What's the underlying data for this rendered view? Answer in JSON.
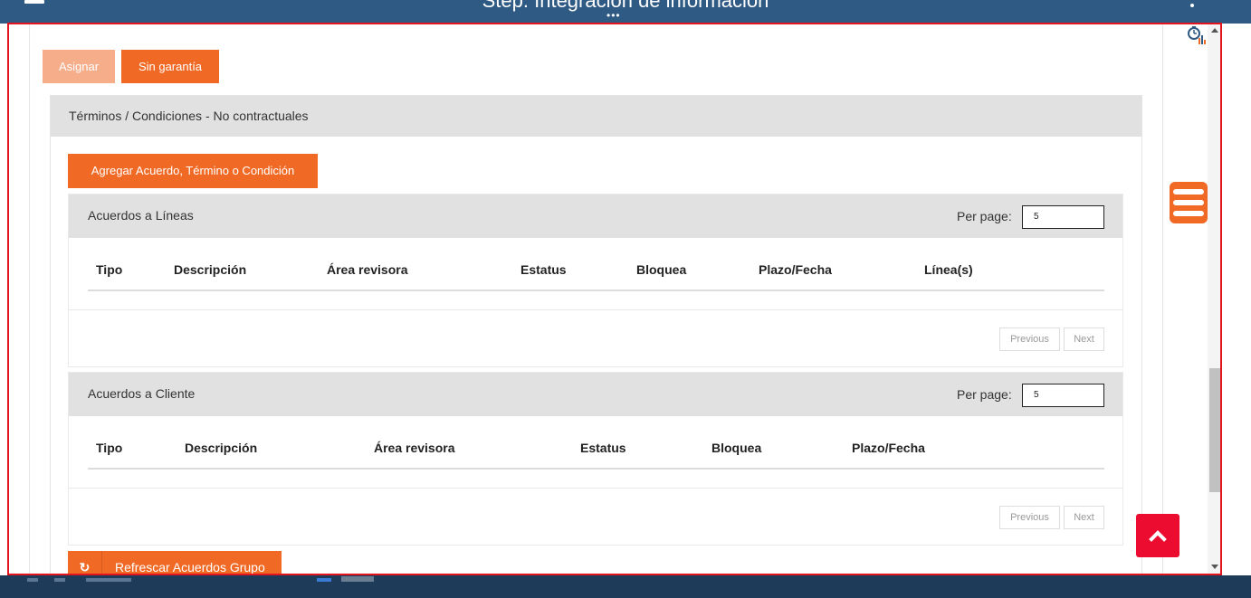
{
  "header": {
    "title": "Step: Integración de información",
    "menu_icon": "hamburger-icon",
    "more_icon": "kebab-icon"
  },
  "toolbar": {
    "assign_label": "Asignar",
    "no_warranty_label": "Sin garantía"
  },
  "panel": {
    "title": "Términos / Condiciones - No contractuales",
    "add_label": "Agregar Acuerdo, Término o Condición",
    "refresh_label": "Refrescar Acuerdos Grupo",
    "refresh_icon": "refresh-icon"
  },
  "lines_table": {
    "title": "Acuerdos a Líneas",
    "per_page_label": "Per page:",
    "per_page_value": "5",
    "columns": [
      "Tipo",
      "Descripción",
      "Área revisora",
      "Estatus",
      "Bloquea",
      "Plazo/Fecha",
      "Línea(s)"
    ],
    "prev_label": "Previous",
    "next_label": "Next"
  },
  "client_table": {
    "title": "Acuerdos a Cliente",
    "per_page_label": "Per page:",
    "per_page_value": "5",
    "columns": [
      "Tipo",
      "Descripción",
      "Área revisora",
      "Estatus",
      "Bloquea",
      "Plazo/Fecha"
    ],
    "prev_label": "Previous",
    "next_label": "Next"
  },
  "colors": {
    "accent": "#f06a25",
    "accent_disabled": "#f5ad8a",
    "header_bg": "#2f5a84",
    "danger": "#ec0c2f"
  }
}
